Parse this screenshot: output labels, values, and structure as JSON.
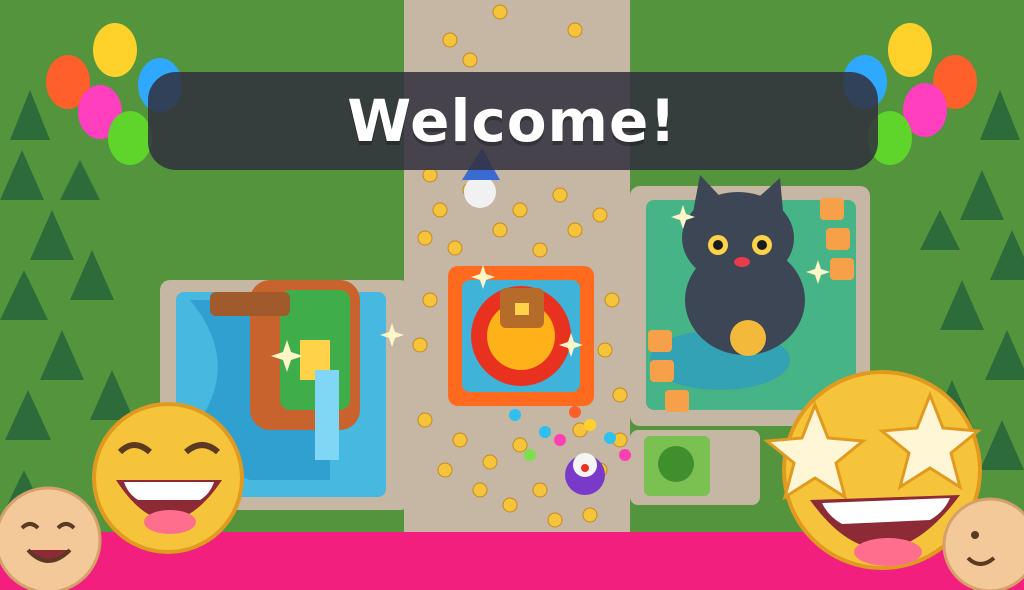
{
  "banner": {
    "title": "Welcome!"
  },
  "colors": {
    "grass": "#4f8f3a",
    "path": "#c6b6a4",
    "banner_bg": "#32303e",
    "accent_pink": "#f21f7e",
    "emoji_yellow": "#f6c43a",
    "water": "#47b8e0",
    "lava_orange": "#ff6a1f",
    "cat_grey": "#3c4654"
  },
  "icons": [
    "balloon-cluster-icon",
    "laughing-emoji-icon",
    "star-eyes-emoji-icon",
    "smiling-face-icon",
    "treasure-chest-icon",
    "lucky-cat-icon",
    "tiki-totem-icon",
    "wizard-icon",
    "clown-icon"
  ]
}
